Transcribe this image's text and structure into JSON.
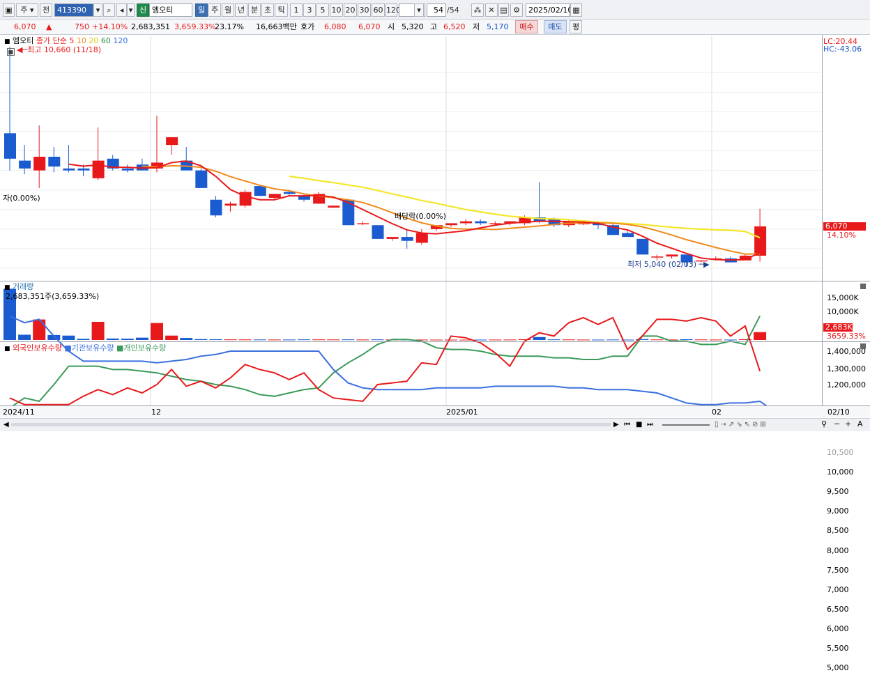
{
  "toolbar": {
    "period_label": "주",
    "prev_label": "전",
    "code": "413390",
    "market_badge": "신",
    "stock_name": "엠오티",
    "periods": [
      "일",
      "주",
      "월",
      "년",
      "분",
      "초",
      "틱"
    ],
    "active_period": "일",
    "intervals": [
      "1",
      "3",
      "5",
      "10",
      "20",
      "30",
      "60",
      "120"
    ],
    "page_current": "54",
    "page_total": "/54",
    "date": "2025/02/10"
  },
  "quote": {
    "price": "6,070",
    "arrow": "▲",
    "change": "750",
    "change_pct": "+14.10%",
    "volume": "2,683,351",
    "volume_ratio": "3,659.33%",
    "turnover": "23.17%",
    "amount": "16,663백만",
    "hoga_label": "호가",
    "hoga_ask": "6,080",
    "hoga_bid": "6,070",
    "open_label": "시",
    "open": "5,320",
    "high_label": "고",
    "high": "6,520",
    "low_label": "저",
    "low": "5,170",
    "buy_label": "매수",
    "sell_label": "매도",
    "eval_label": "평"
  },
  "price_pane": {
    "name": "엠오티",
    "ma_label": "종가 단순",
    "ma_periods": [
      "5",
      "10",
      "20",
      "60",
      "120"
    ],
    "max_label": "최고 10,660 (11/18)",
    "min_label": "최저 5,040 (02/03)",
    "ex_right_label": "자(0.00%)",
    "dividend_label": "배당락(0.00%)",
    "lc": "LC:20.44",
    "hc": "HC:-43.06",
    "last_price": "6,070",
    "last_pct": "14.10%",
    "y_ticks": [
      "10,500",
      "10,000",
      "9,500",
      "9,000",
      "8,500",
      "8,000",
      "7,500",
      "7,000",
      "6,500",
      "6,000",
      "5,500",
      "5,000"
    ]
  },
  "volume_pane": {
    "title": "거래량",
    "info": "2,683,351주(3,659.33%)",
    "y_ticks": [
      "15,000K",
      "10,000K"
    ],
    "last_vol": "2,683K",
    "last_ratio": "3659.33%"
  },
  "holding_pane": {
    "foreign": "외국인보유수량",
    "institution": "기관보유수량",
    "individual": "개인보유수량",
    "y_ticks": [
      "1,400,000",
      "1,300,000",
      "1,200,000"
    ]
  },
  "x_axis": [
    "2024/11",
    "12",
    "2025/01",
    "02",
    "02/10"
  ],
  "colors": {
    "up": "#e8191b",
    "down": "#1a5ccf",
    "ma5": "#e8191b",
    "ma10": "#f08a1c",
    "ma20": "#f4e62a",
    "foreign": "#e8191b",
    "institution": "#3a6fe0",
    "individual": "#3a9a5a"
  },
  "chart_data": {
    "type": "candlestick",
    "candles": [
      {
        "o": 8450,
        "h": 10660,
        "l": 7500,
        "c": 7800
      },
      {
        "o": 7750,
        "h": 8150,
        "l": 7400,
        "c": 7550
      },
      {
        "o": 7500,
        "h": 8650,
        "l": 7050,
        "c": 7850
      },
      {
        "o": 7850,
        "h": 8100,
        "l": 7450,
        "c": 7600
      },
      {
        "o": 7550,
        "h": 8150,
        "l": 7450,
        "c": 7500
      },
      {
        "o": 7550,
        "h": 7650,
        "l": 7350,
        "c": 7500
      },
      {
        "o": 7300,
        "h": 8600,
        "l": 7250,
        "c": 7750
      },
      {
        "o": 7800,
        "h": 7900,
        "l": 7500,
        "c": 7550
      },
      {
        "o": 7550,
        "h": 7650,
        "l": 7450,
        "c": 7500
      },
      {
        "o": 7650,
        "h": 7800,
        "l": 7500,
        "c": 7500
      },
      {
        "o": 7550,
        "h": 8900,
        "l": 7450,
        "c": 7700
      },
      {
        "o": 8150,
        "h": 8350,
        "l": 7900,
        "c": 8350
      },
      {
        "o": 7750,
        "h": 8100,
        "l": 7500,
        "c": 7500
      },
      {
        "o": 7500,
        "h": 7550,
        "l": 7050,
        "c": 7050
      },
      {
        "o": 6750,
        "h": 6850,
        "l": 6300,
        "c": 6350
      },
      {
        "o": 6600,
        "h": 6700,
        "l": 6450,
        "c": 6650
      },
      {
        "o": 6600,
        "h": 7000,
        "l": 6550,
        "c": 6950
      },
      {
        "o": 7100,
        "h": 7100,
        "l": 6850,
        "c": 6850
      },
      {
        "o": 6800,
        "h": 6900,
        "l": 6750,
        "c": 6900
      },
      {
        "o": 6950,
        "h": 7000,
        "l": 6850,
        "c": 6900
      },
      {
        "o": 6850,
        "h": 6900,
        "l": 6700,
        "c": 6750
      },
      {
        "o": 6650,
        "h": 6950,
        "l": 6650,
        "c": 6900
      },
      {
        "o": 6550,
        "h": 6600,
        "l": 6550,
        "c": 6600
      },
      {
        "o": 6750,
        "h": 6750,
        "l": 6100,
        "c": 6100
      },
      {
        "o": 6150,
        "h": 6200,
        "l": 6100,
        "c": 6150
      },
      {
        "o": 6100,
        "h": 6100,
        "l": 5750,
        "c": 5750
      },
      {
        "o": 5750,
        "h": 5800,
        "l": 5700,
        "c": 5800
      },
      {
        "o": 5800,
        "h": 6000,
        "l": 5500,
        "c": 5700
      },
      {
        "o": 5650,
        "h": 6000,
        "l": 5600,
        "c": 5900
      },
      {
        "o": 6000,
        "h": 6100,
        "l": 5950,
        "c": 6100
      },
      {
        "o": 6100,
        "h": 6150,
        "l": 6050,
        "c": 6150
      },
      {
        "o": 6150,
        "h": 6250,
        "l": 6100,
        "c": 6200
      },
      {
        "o": 6200,
        "h": 6250,
        "l": 6100,
        "c": 6150
      },
      {
        "o": 6150,
        "h": 6200,
        "l": 6100,
        "c": 6150
      },
      {
        "o": 6150,
        "h": 6200,
        "l": 6100,
        "c": 6200
      },
      {
        "o": 6150,
        "h": 6350,
        "l": 6100,
        "c": 6300
      },
      {
        "o": 6300,
        "h": 7200,
        "l": 6150,
        "c": 6200
      },
      {
        "o": 6250,
        "h": 6300,
        "l": 6050,
        "c": 6100
      },
      {
        "o": 6100,
        "h": 6250,
        "l": 6050,
        "c": 6200
      },
      {
        "o": 6150,
        "h": 6150,
        "l": 6100,
        "c": 6150
      },
      {
        "o": 6150,
        "h": 6200,
        "l": 6000,
        "c": 6100
      },
      {
        "o": 6100,
        "h": 6150,
        "l": 5850,
        "c": 5850
      },
      {
        "o": 5900,
        "h": 5950,
        "l": 5800,
        "c": 5800
      },
      {
        "o": 5750,
        "h": 5750,
        "l": 5350,
        "c": 5350
      },
      {
        "o": 5300,
        "h": 5350,
        "l": 5200,
        "c": 5300
      },
      {
        "o": 5300,
        "h": 5350,
        "l": 5250,
        "c": 5350
      },
      {
        "o": 5350,
        "h": 5350,
        "l": 5040,
        "c": 5150
      },
      {
        "o": 5200,
        "h": 5200,
        "l": 5150,
        "c": 5200
      },
      {
        "o": 5250,
        "h": 5300,
        "l": 5200,
        "c": 5250
      },
      {
        "o": 5250,
        "h": 5300,
        "l": 5150,
        "c": 5150
      },
      {
        "o": 5200,
        "h": 5350,
        "l": 5200,
        "c": 5320
      },
      {
        "o": 5320,
        "h": 6520,
        "l": 5170,
        "c": 6070
      }
    ],
    "ma5": [
      null,
      null,
      null,
      null,
      7660,
      7610,
      7640,
      7580,
      7580,
      7560,
      7570,
      7700,
      7740,
      7620,
      7350,
      7010,
      6840,
      6750,
      6750,
      6850,
      6850,
      6860,
      6820,
      6680,
      6500,
      6320,
      6140,
      5980,
      5900,
      5880,
      5920,
      5960,
      6030,
      6100,
      6150,
      6180,
      6200,
      6200,
      6190,
      6180,
      6150,
      6050,
      5980,
      5820,
      5640,
      5510,
      5380,
      5260,
      5220,
      5210,
      5220,
      5400
    ],
    "ma10": [
      null,
      null,
      null,
      null,
      null,
      null,
      null,
      null,
      null,
      7610,
      7590,
      7620,
      7610,
      7580,
      7480,
      7340,
      7230,
      7120,
      7030,
      6980,
      6900,
      6850,
      6800,
      6750,
      6680,
      6560,
      6420,
      6280,
      6160,
      6080,
      6020,
      6000,
      6000,
      5990,
      6020,
      6050,
      6080,
      6120,
      6150,
      6160,
      6160,
      6150,
      6120,
      6060,
      5960,
      5850,
      5730,
      5630,
      5530,
      5440,
      5360,
      5370
    ],
    "ma20": [
      null,
      null,
      null,
      null,
      null,
      null,
      null,
      null,
      null,
      null,
      null,
      null,
      null,
      null,
      null,
      null,
      null,
      null,
      null,
      7350,
      7300,
      7240,
      7190,
      7130,
      7070,
      6990,
      6900,
      6820,
      6730,
      6660,
      6580,
      6500,
      6440,
      6380,
      6330,
      6300,
      6270,
      6260,
      6240,
      6210,
      6180,
      6160,
      6140,
      6120,
      6080,
      6050,
      6020,
      6000,
      5980,
      5970,
      5940,
      5780
    ],
    "volume_k": [
      17500,
      1800,
      7000,
      1700,
      1500,
      400,
      6200,
      500,
      450,
      800,
      5800,
      1500,
      700,
      300,
      250,
      200,
      180,
      170,
      160,
      150,
      200,
      190,
      170,
      200,
      160,
      190,
      150,
      140,
      130,
      120,
      110,
      110,
      120,
      140,
      150,
      250,
      1000,
      200,
      180,
      140,
      130,
      160,
      120,
      300,
      180,
      150,
      250,
      180,
      140,
      130,
      260,
      2683
    ],
    "foreign": [
      1160,
      1140,
      1140,
      1140,
      1140,
      1165,
      1185,
      1170,
      1190,
      1175,
      1200,
      1245,
      1195,
      1210,
      1190,
      1220,
      1260,
      1245,
      1235,
      1215,
      1235,
      1185,
      1160,
      1155,
      1150,
      1200,
      1205,
      1210,
      1265,
      1260,
      1345,
      1340,
      1325,
      1295,
      1255,
      1330,
      1355,
      1345,
      1385,
      1400,
      1380,
      1400,
      1305,
      1345,
      1395,
      1395,
      1390,
      1400,
      1390,
      1345,
      1375,
      1240
    ],
    "institution": [
      1405,
      1385,
      1395,
      1345,
      1300,
      1270,
      1270,
      1270,
      1270,
      1270,
      1265,
      1270,
      1275,
      1285,
      1290,
      1300,
      1300,
      1300,
      1300,
      1300,
      1300,
      1300,
      1245,
      1205,
      1190,
      1185,
      1185,
      1185,
      1185,
      1190,
      1190,
      1190,
      1190,
      1195,
      1195,
      1195,
      1195,
      1195,
      1190,
      1190,
      1185,
      1185,
      1185,
      1180,
      1175,
      1160,
      1145,
      1140,
      1140,
      1145,
      1145,
      1150,
      1120
    ],
    "individual": [
      1130,
      1160,
      1150,
      1200,
      1255,
      1255,
      1255,
      1245,
      1245,
      1240,
      1235,
      1225,
      1215,
      1210,
      1200,
      1195,
      1185,
      1170,
      1165,
      1175,
      1185,
      1190,
      1235,
      1265,
      1290,
      1320,
      1335,
      1335,
      1330,
      1310,
      1305,
      1305,
      1300,
      1290,
      1285,
      1285,
      1285,
      1280,
      1280,
      1275,
      1275,
      1285,
      1285,
      1345,
      1345,
      1330,
      1330,
      1320,
      1320,
      1330,
      1320,
      1405
    ]
  }
}
